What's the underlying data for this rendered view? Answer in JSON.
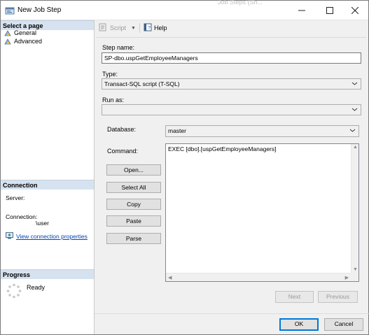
{
  "window": {
    "title": "New Job Step",
    "background_title_fragment": "Job Steps (Sh..."
  },
  "left": {
    "select_page_header": "Select a page",
    "pages": [
      "General",
      "Advanced"
    ],
    "connection_header": "Connection",
    "server_label": "Server:",
    "server_value": "",
    "connection_label": "Connection:",
    "connection_value": "\\user",
    "view_connection_link": "View connection properties",
    "progress_header": "Progress",
    "progress_status": "Ready"
  },
  "toolbar": {
    "script_label": "Script",
    "help_label": "Help"
  },
  "form": {
    "step_name_label": "Step name:",
    "step_name_value": "SP-dbo.uspGetEmployeeManagers",
    "type_label": "Type:",
    "type_value": "Transact-SQL script (T-SQL)",
    "run_as_label": "Run as:",
    "run_as_value": "",
    "database_label": "Database:",
    "database_value": "master",
    "command_label": "Command:",
    "command_text": "EXEC [dbo].[uspGetEmployeeManagers]"
  },
  "command_buttons": {
    "open": "Open...",
    "select_all": "Select All",
    "copy": "Copy",
    "paste": "Paste",
    "parse": "Parse"
  },
  "nav_buttons": {
    "next": "Next",
    "previous": "Previous"
  },
  "dialog_buttons": {
    "ok": "OK",
    "cancel": "Cancel"
  },
  "colors": {
    "section_header_bg": "#d6e2ef",
    "link": "#0645ad",
    "focus_border": "#0078d7"
  },
  "icons": [
    "app-icon",
    "page-icon",
    "script-icon",
    "help-icon",
    "connection-icon",
    "spinner-icon",
    "chevron-down-icon"
  ]
}
